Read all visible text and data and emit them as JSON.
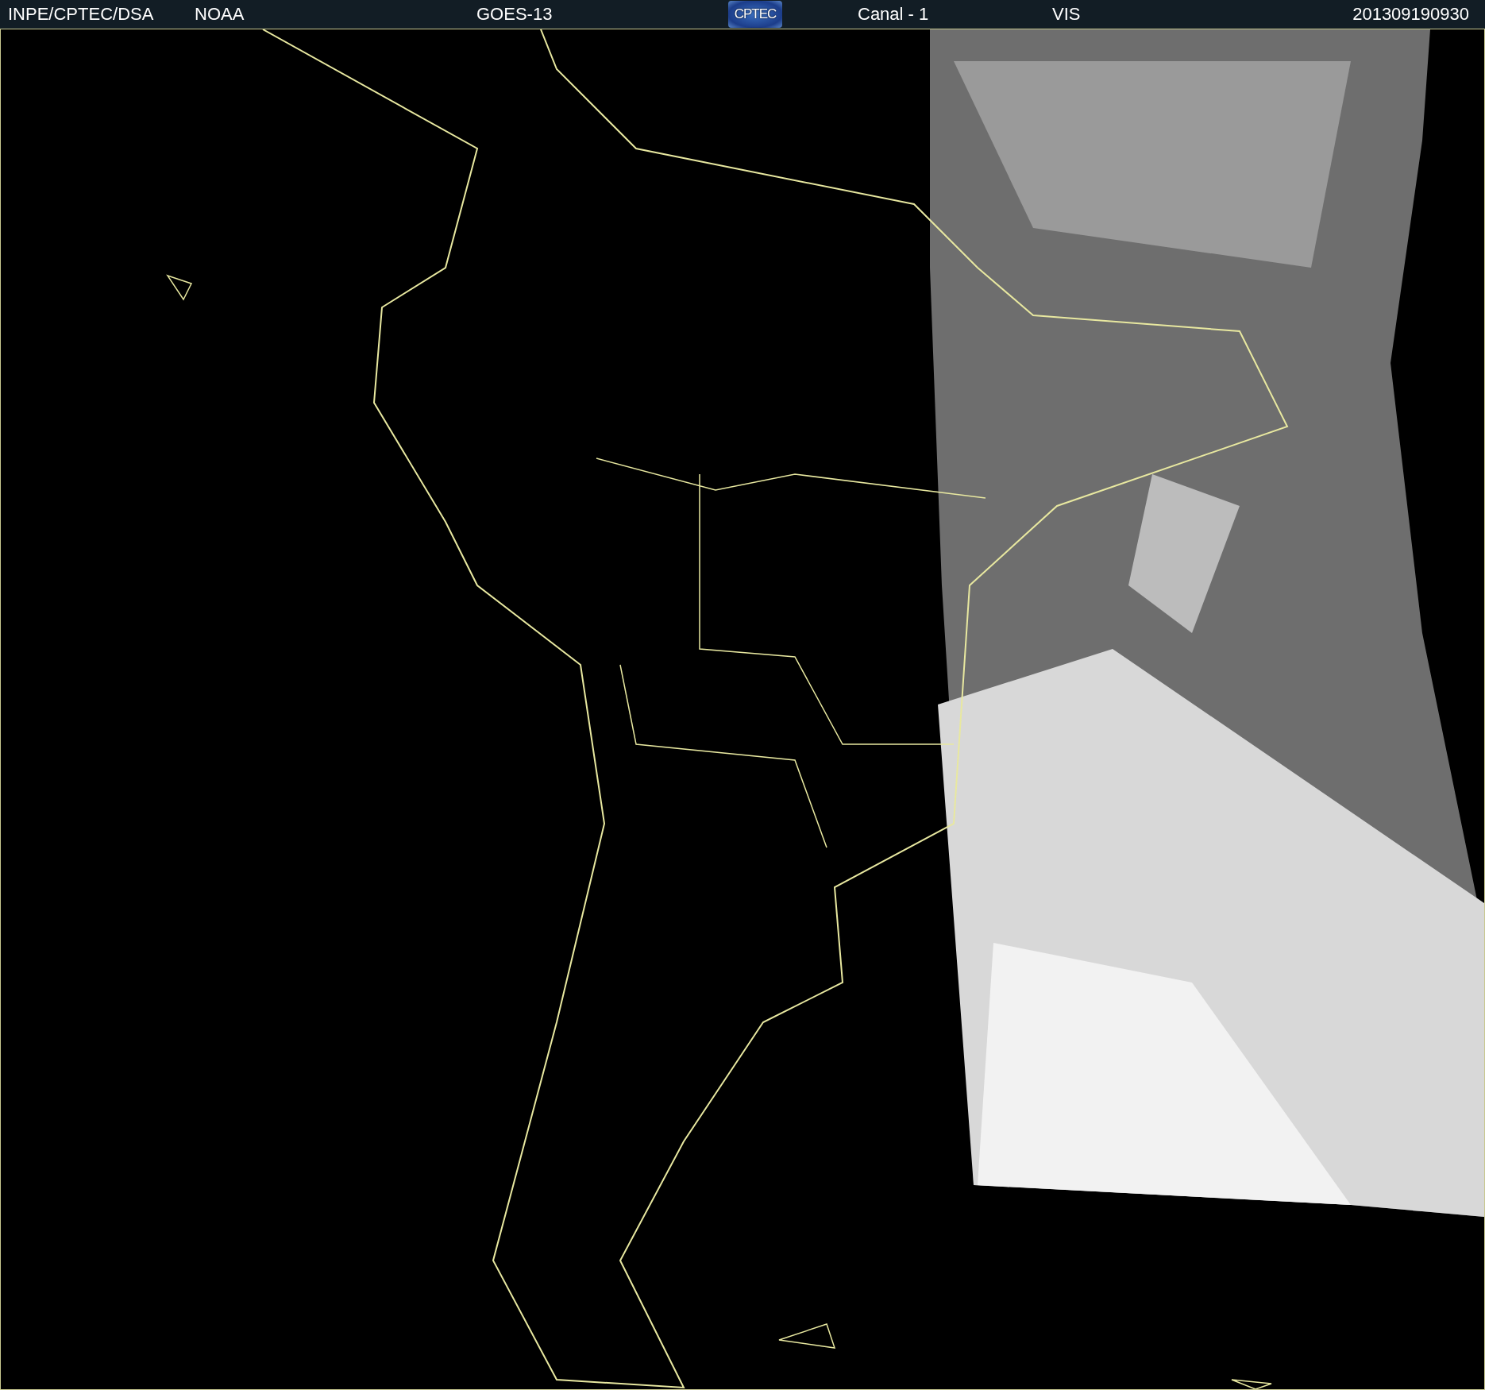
{
  "header": {
    "source": "INPE/CPTEC/DSA",
    "agency": "NOAA",
    "satellite": "GOES-13",
    "logo": "CPTEC",
    "channel": "Canal - 1",
    "band": "VIS",
    "timestamp": "201309190930"
  }
}
